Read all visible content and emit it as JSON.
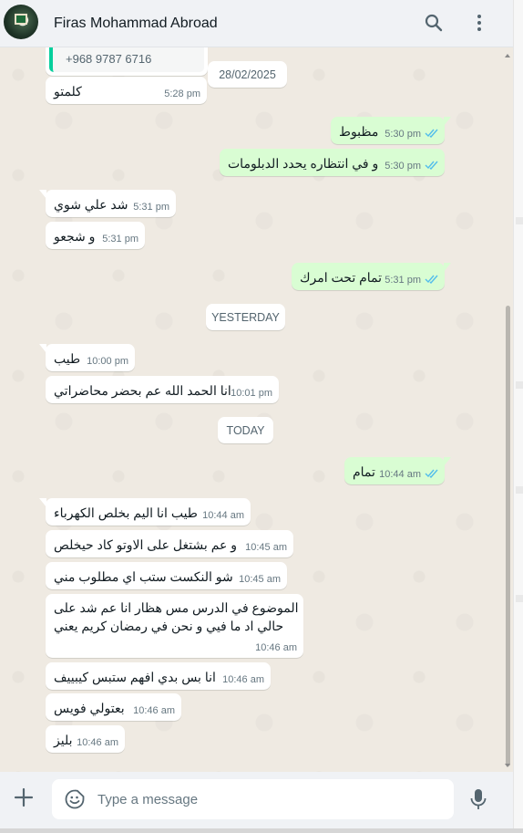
{
  "header": {
    "contact_name": "Firas Mohammad Abroad",
    "avatar_icon": "avatar-image",
    "search_icon": "search-icon",
    "menu_icon": "more-vertical-icon"
  },
  "colors": {
    "outgoing_bubble": "#d9fdd3",
    "incoming_bubble": "#ffffff",
    "chat_background": "#efeae2",
    "read_ticks": "#53bdeb",
    "quote_bar": "#06cf9c"
  },
  "quoted_contact": {
    "phone": "+968 9787 6716"
  },
  "date_markers": {
    "d1": "28/02/2025",
    "d2": "YESTERDAY",
    "d3": "TODAY"
  },
  "messages": [
    {
      "dir": "in",
      "text": "كلمتو",
      "time": "5:28 pm"
    },
    {
      "dir": "out",
      "text": "مظبوط",
      "time": "5:30 pm",
      "status": "read"
    },
    {
      "dir": "out",
      "text": "و في انتظاره يحدد الدبلومات",
      "time": "5:30 pm",
      "status": "read"
    },
    {
      "dir": "in",
      "text": "شد علي شوي",
      "time": "5:31 pm"
    },
    {
      "dir": "in",
      "text": "و شجعو",
      "time": "5:31 pm"
    },
    {
      "dir": "out",
      "text": "تمام تحت امرك",
      "time": "5:31 pm",
      "status": "read"
    },
    {
      "dir": "in",
      "text": "طيب",
      "time": "10:00 pm"
    },
    {
      "dir": "in",
      "text": "انا الحمد الله عم بحضر محاضراتي",
      "time": "10:01 pm"
    },
    {
      "dir": "out",
      "text": "تمام",
      "time": "10:44 am",
      "status": "read"
    },
    {
      "dir": "in",
      "text": "طيب انا اليم بخلص الكهرباء",
      "time": "10:44 am"
    },
    {
      "dir": "in",
      "text": "و عم بشتغل على الاوتو كاد حيخلص",
      "time": "10:45 am"
    },
    {
      "dir": "in",
      "text": "شو النكست ستب اي مطلوب مني",
      "time": "10:45 am"
    },
    {
      "dir": "in",
      "line1": "الموضوع في الدرس مس هظار انا عم شد على",
      "line2": "حالي اد ما فيي و نحن في رمضان كريم يعني",
      "time": "10:46 am"
    },
    {
      "dir": "in",
      "text": "انا بس بدي افهم ستبس كيبييف",
      "time": "10:46 am"
    },
    {
      "dir": "in",
      "text": "بعتولي فويس",
      "time": "10:46 am"
    },
    {
      "dir": "in",
      "text": "بليز",
      "time": "10:46 am"
    }
  ],
  "composer": {
    "placeholder": "Type a message",
    "attach_icon": "plus-icon",
    "emoji_icon": "emoji-icon",
    "mic_icon": "microphone-icon"
  }
}
